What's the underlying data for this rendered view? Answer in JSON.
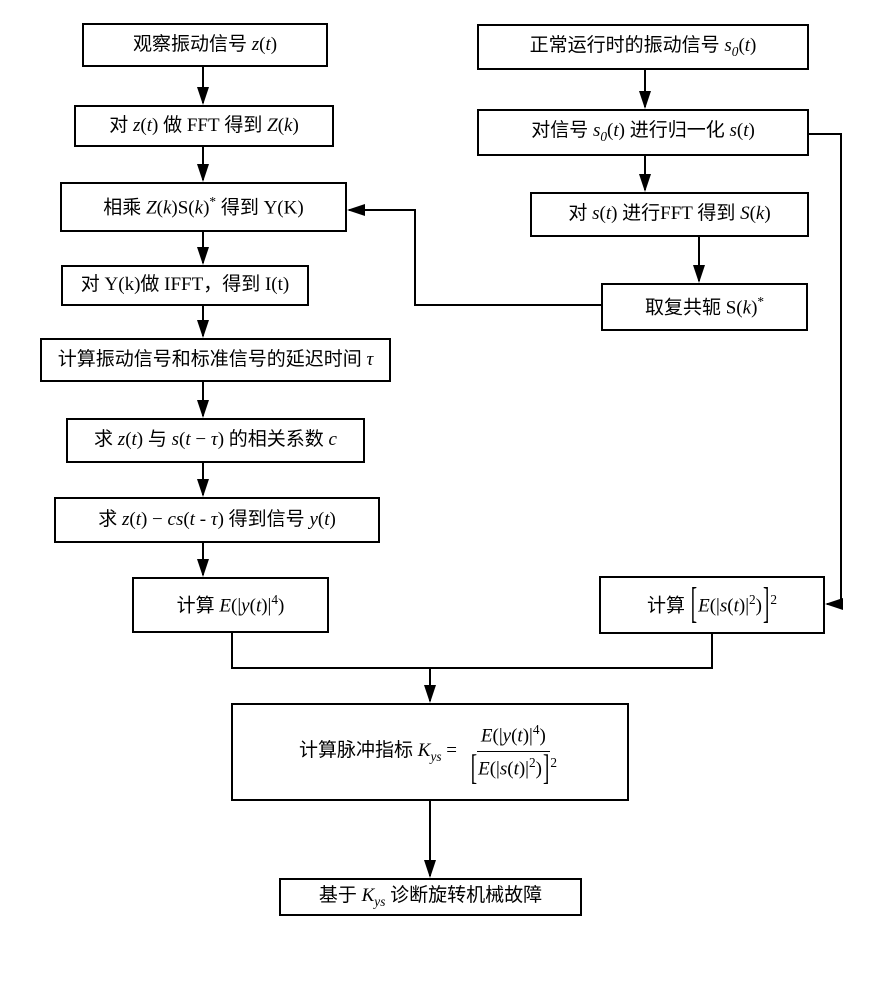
{
  "chart_data": {
    "type": "flowchart",
    "left_branch": [
      {
        "id": "b1",
        "text": "观察振动信号 z(t)"
      },
      {
        "id": "b2",
        "text": "对 z(t) 做 FFT 得到 Z(k)"
      },
      {
        "id": "b3",
        "text": "相乘 Z(k)S(k)* 得到 Y(K)"
      },
      {
        "id": "b4",
        "text": "对 Y(k)做 IFFT，得到 I(t)"
      },
      {
        "id": "b5",
        "text": "计算振动信号和标准信号的延迟时间 τ"
      },
      {
        "id": "b6",
        "text": "求 z(t) 与 s(t−τ) 的相关系数 c"
      },
      {
        "id": "b7",
        "text": "求 z(t)−cs(t−τ) 得到信号 y(t)"
      },
      {
        "id": "b8",
        "text": "计算 E(|y(t)|^4)"
      }
    ],
    "right_branch": [
      {
        "id": "r1",
        "text": "正常运行时的振动信号 s0(t)"
      },
      {
        "id": "r2",
        "text": "对信号 s0(t) 进行归一化 s(t)"
      },
      {
        "id": "r3",
        "text": "对 s(t) 进行FFT 得到 S(k)"
      },
      {
        "id": "r4",
        "text": "取复共轭 S(k)*"
      },
      {
        "id": "r5",
        "text": "计算 [E(|s(t)|^2)]^2"
      }
    ],
    "merge": [
      {
        "id": "m1",
        "text": "计算脉冲指标 Kys = E(|y(t)|^4) / [E(|s(t)|^2)]^2"
      },
      {
        "id": "m2",
        "text": "基于 Kys 诊断旋转机械故障"
      }
    ],
    "edges": [
      [
        "b1",
        "b2"
      ],
      [
        "b2",
        "b3"
      ],
      [
        "b3",
        "b4"
      ],
      [
        "b4",
        "b5"
      ],
      [
        "b5",
        "b6"
      ],
      [
        "b6",
        "b7"
      ],
      [
        "b7",
        "b8"
      ],
      [
        "r1",
        "r2"
      ],
      [
        "r2",
        "r3"
      ],
      [
        "r3",
        "r4"
      ],
      [
        "r4",
        "b3"
      ],
      [
        "r2",
        "r5"
      ],
      [
        "b8",
        "m1"
      ],
      [
        "r5",
        "m1"
      ],
      [
        "m1",
        "m2"
      ]
    ]
  },
  "labels": {
    "observe": "观察振动信号",
    "do_fft": "做",
    "fft": "FFT",
    "get": "得到",
    "multiply": "相乘",
    "ifft_left": "对",
    "ifft": "Y(k)做 IFFT，得到 I(t)",
    "delay": "计算振动信号和标准信号的延迟时间",
    "corr_a": "求",
    "corr_b": "与",
    "corr_c": "的相关系数",
    "sub_get": "得到信号",
    "compute": "计算",
    "normal_sig": "正常运行时的振动信号",
    "nrm_a": "对信号",
    "nrm_b": "进行归一化",
    "fft_r_a": "对",
    "fft_r_b": "进行FFT 得到",
    "conj": "取复共轭",
    "kys_label": "计算脉冲指标",
    "diag_a": "基于",
    "diag_b": "诊断旋转机械故障"
  }
}
